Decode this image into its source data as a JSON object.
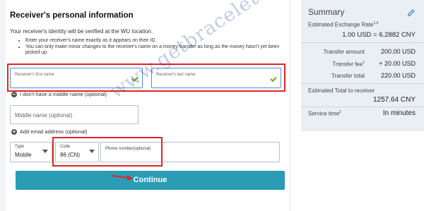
{
  "form": {
    "title": "Receiver's personal information",
    "subtitle": "Your receiver's identity will be verified at the WU location.",
    "bullets": [
      "Enter your receiver's name exactly as it appears on their ID.",
      "You can only make minor changes to the receiver's name on a money transfer as long as the money hasn't yet been picked up."
    ],
    "first_name_label": "Receiver's first name",
    "last_name_label": "Receiver's last name",
    "no_middle_name": "I don't have a middle name (optional)",
    "middle_name_placeholder": "Middle name (optional)",
    "add_email": "Add email address (optional)",
    "type_label": "Type",
    "type_value": "Mobile",
    "code_label": "Code",
    "code_value": "86 (CN)",
    "phone_label": "Phone number(optional)",
    "continue_label": "Continue"
  },
  "summary": {
    "title": "Summary",
    "rate_label": "Estimated Exchange Rate",
    "rate_sup": "1,4",
    "rate_value": "1.00 USD = 6.2882 CNY",
    "transfer_amount_label": "Transfer amount",
    "transfer_amount_value": "200.00 USD",
    "transfer_fee_label": "Transfer fee",
    "transfer_fee_sup": "1",
    "transfer_fee_value": "+ 20.00 USD",
    "transfer_total_label": "Transfer total",
    "transfer_total_value": "220.00 USD",
    "estimated_total_label": "Estimated Total to receiver",
    "estimated_total_value": "1257.64 CNY",
    "service_time_label": "Service time",
    "service_time_sup": "2",
    "service_time_value": "In minutes"
  },
  "watermark": "www.getbracelets.net",
  "colors": {
    "accent": "#2a9db5",
    "highlight": "#e02424",
    "valid": "#5fae2b",
    "summary_bg": "#eaeff4"
  }
}
